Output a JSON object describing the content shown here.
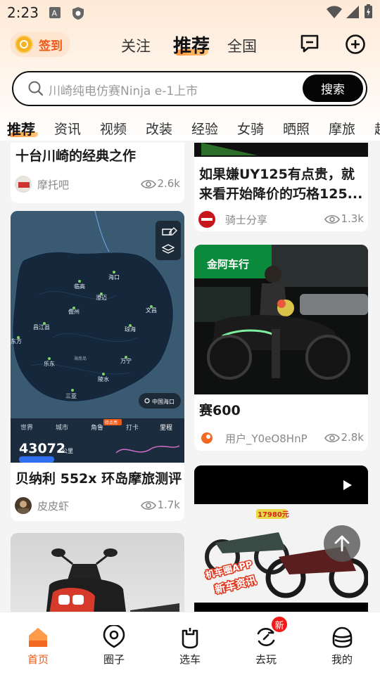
{
  "status_bar": {
    "time": "2:23"
  },
  "header": {
    "signin_label": "签到",
    "tabs": [
      {
        "label": "关注",
        "active": false
      },
      {
        "label": "推荐",
        "active": true
      },
      {
        "label": "全国",
        "active": false
      }
    ],
    "icons": [
      "message-icon",
      "add-icon"
    ]
  },
  "search": {
    "placeholder": "川崎纯电仿赛Ninja e-1上市",
    "button_label": "搜索"
  },
  "categories": [
    "推荐",
    "资讯",
    "视频",
    "改装",
    "经验",
    "女骑",
    "晒照",
    "摩旅",
    "越"
  ],
  "feed": {
    "left": [
      {
        "title": "十台川崎的经典之作",
        "author": "摩托吧",
        "views": "2.6k"
      },
      {
        "title": "贝纳利 552x 环岛摩旅测评",
        "author": "皮皮虾",
        "views": "1.7k",
        "map": {
          "places": [
            "海口",
            "临高",
            "澄迈",
            "儋州",
            "文昌",
            "昌江县",
            "琼海",
            "东方",
            "乐东",
            "海南岛",
            "万宁",
            "陵水",
            "三亚"
          ],
          "location_label": "中国海口",
          "tabs": [
            "世界",
            "城市",
            "角鲁",
            "打卡",
            "里程"
          ],
          "corner_badge": "待点亮",
          "mileage_value": "43072",
          "mileage_unit": "公里"
        }
      },
      {
        "title": "",
        "author": "",
        "views": ""
      }
    ],
    "right": [
      {
        "title": "如果嫌UY125有点贵，就来看开始降价的巧格125...",
        "author": "骑士分享",
        "views": "1.3k"
      },
      {
        "title": "赛600",
        "author": "用户_Y0eO8HnP",
        "views": "2.8k",
        "shop_sign": "金阿车行"
      },
      {
        "title": "",
        "author": "",
        "views": "",
        "price_tag": "17980元",
        "overlay_line1": "机车圈APP",
        "overlay_line2": "新车资讯"
      }
    ]
  },
  "bottom_nav": [
    {
      "label": "首页",
      "icon": "home-icon",
      "active": true
    },
    {
      "label": "圈子",
      "icon": "circle-icon",
      "active": false
    },
    {
      "label": "选车",
      "icon": "garage-icon",
      "active": false
    },
    {
      "label": "去玩",
      "icon": "refresh-play-icon",
      "active": false,
      "badge": "新"
    },
    {
      "label": "我的",
      "icon": "helmet-icon",
      "active": false
    }
  ],
  "colors": {
    "accent": "#f05a19",
    "search_button": "#050505",
    "badge": "#f21b1b"
  }
}
